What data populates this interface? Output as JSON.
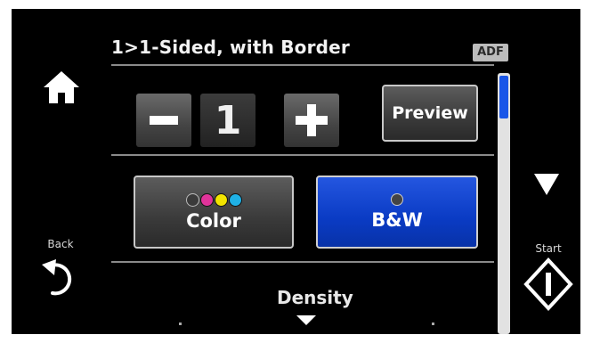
{
  "header": {
    "title": "1>1-Sided, with Border",
    "adf_badge": "ADF"
  },
  "left_panel": {
    "home_icon": "home-icon",
    "back_label": "Back",
    "back_icon": "back-arrow-icon"
  },
  "copies": {
    "minus_icon": "minus-icon",
    "value": "1",
    "plus_icon": "plus-icon",
    "preview_label": "Preview"
  },
  "color_mode": {
    "options": [
      {
        "label": "Color",
        "selected": false,
        "dot_colors": [
          "#3a3a3a",
          "#e0339a",
          "#f2e400",
          "#1fb1e6"
        ]
      },
      {
        "label": "B&W",
        "selected": true,
        "dot_colors": [
          "#444444"
        ]
      }
    ]
  },
  "setting": {
    "label": "Density",
    "expand_icon": "caret-down-icon"
  },
  "right_panel": {
    "scroll_down_icon": "scroll-down-icon",
    "start_label": "Start",
    "start_icon": "start-diamond-icon"
  },
  "colors": {
    "selected_blue": "#0a3bc4",
    "scroll_thumb": "#1a56e8",
    "background": "#000000"
  }
}
